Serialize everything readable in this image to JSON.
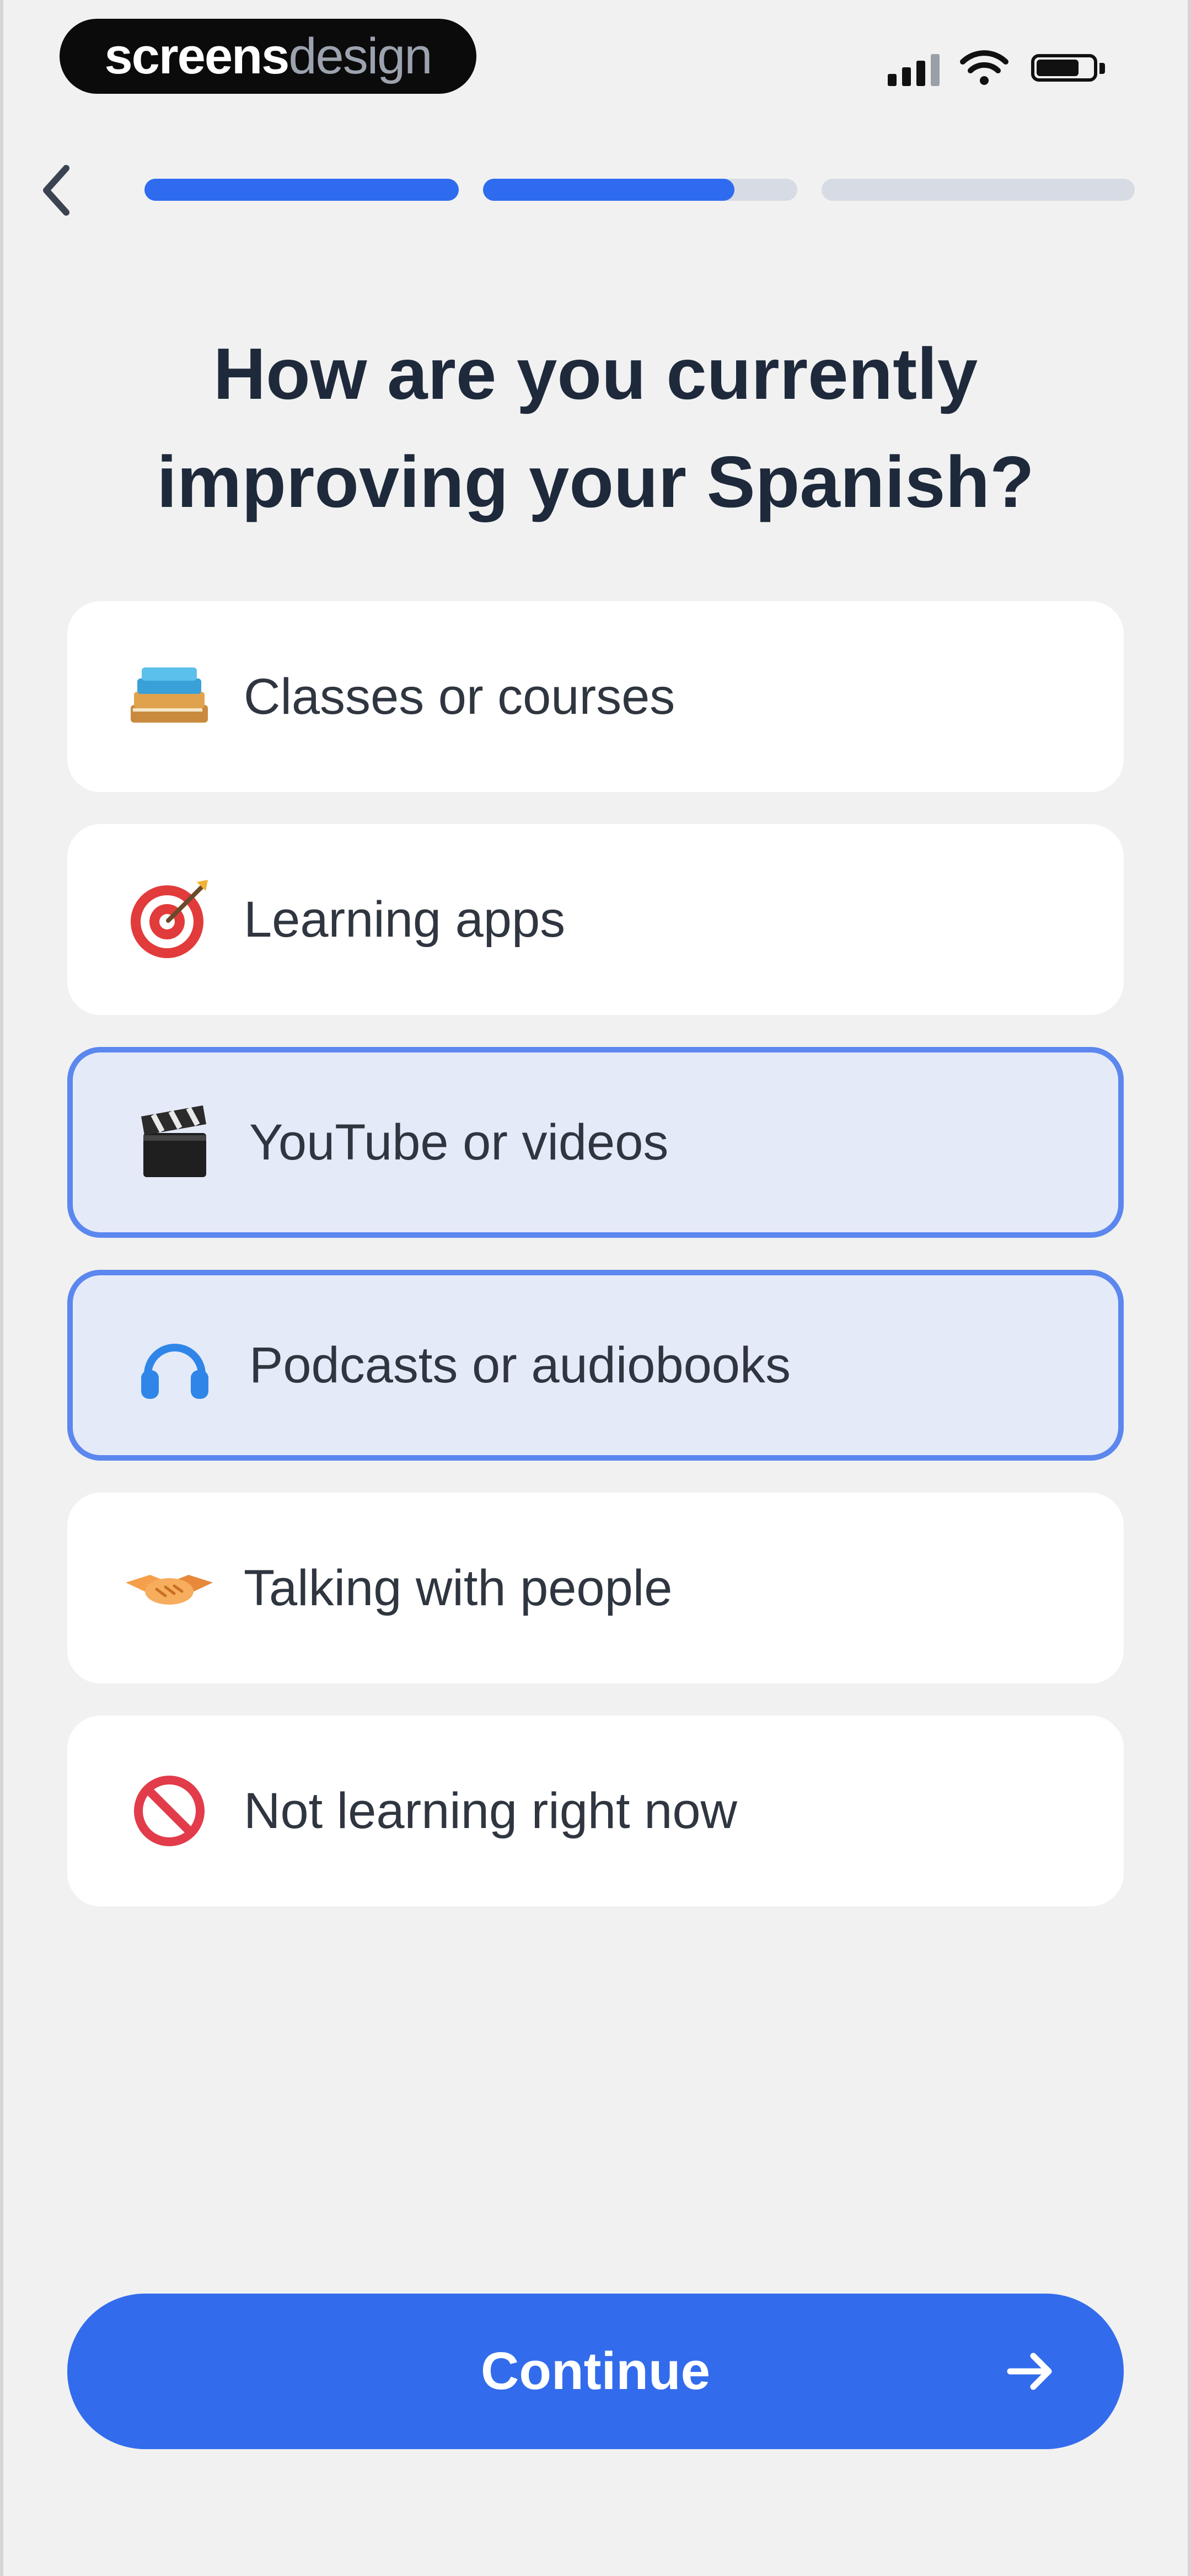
{
  "brand": {
    "part1": "screens",
    "part2": "design"
  },
  "status_bar": {
    "signal_icon": "signal-bars-icon",
    "wifi_icon": "wifi-icon",
    "battery_icon": "battery-icon"
  },
  "nav": {
    "back_icon": "chevron-left-icon",
    "progress": {
      "segments": 3,
      "filled": [
        1,
        0.8,
        0
      ]
    }
  },
  "question": {
    "line1": "How are you currently",
    "line2": "improving your Spanish?"
  },
  "options": [
    {
      "label": "Classes or courses",
      "icon": "books-icon",
      "selected": false
    },
    {
      "label": "Learning apps",
      "icon": "target-icon",
      "selected": false
    },
    {
      "label": "YouTube or videos",
      "icon": "clapperboard-icon",
      "selected": true
    },
    {
      "label": "Podcasts or audiobooks",
      "icon": "headphones-icon",
      "selected": true
    },
    {
      "label": "Talking with people",
      "icon": "handshake-icon",
      "selected": false
    },
    {
      "label": "Not learning right now",
      "icon": "prohibited-icon",
      "selected": false
    }
  ],
  "continue": {
    "label": "Continue",
    "icon": "arrow-right-icon"
  },
  "colors": {
    "accent": "#326cec",
    "selected_bg": "#e5eaf9",
    "selected_border": "#5b87ee",
    "progress_track": "#d7dbe4",
    "background": "#f1f1f1"
  }
}
